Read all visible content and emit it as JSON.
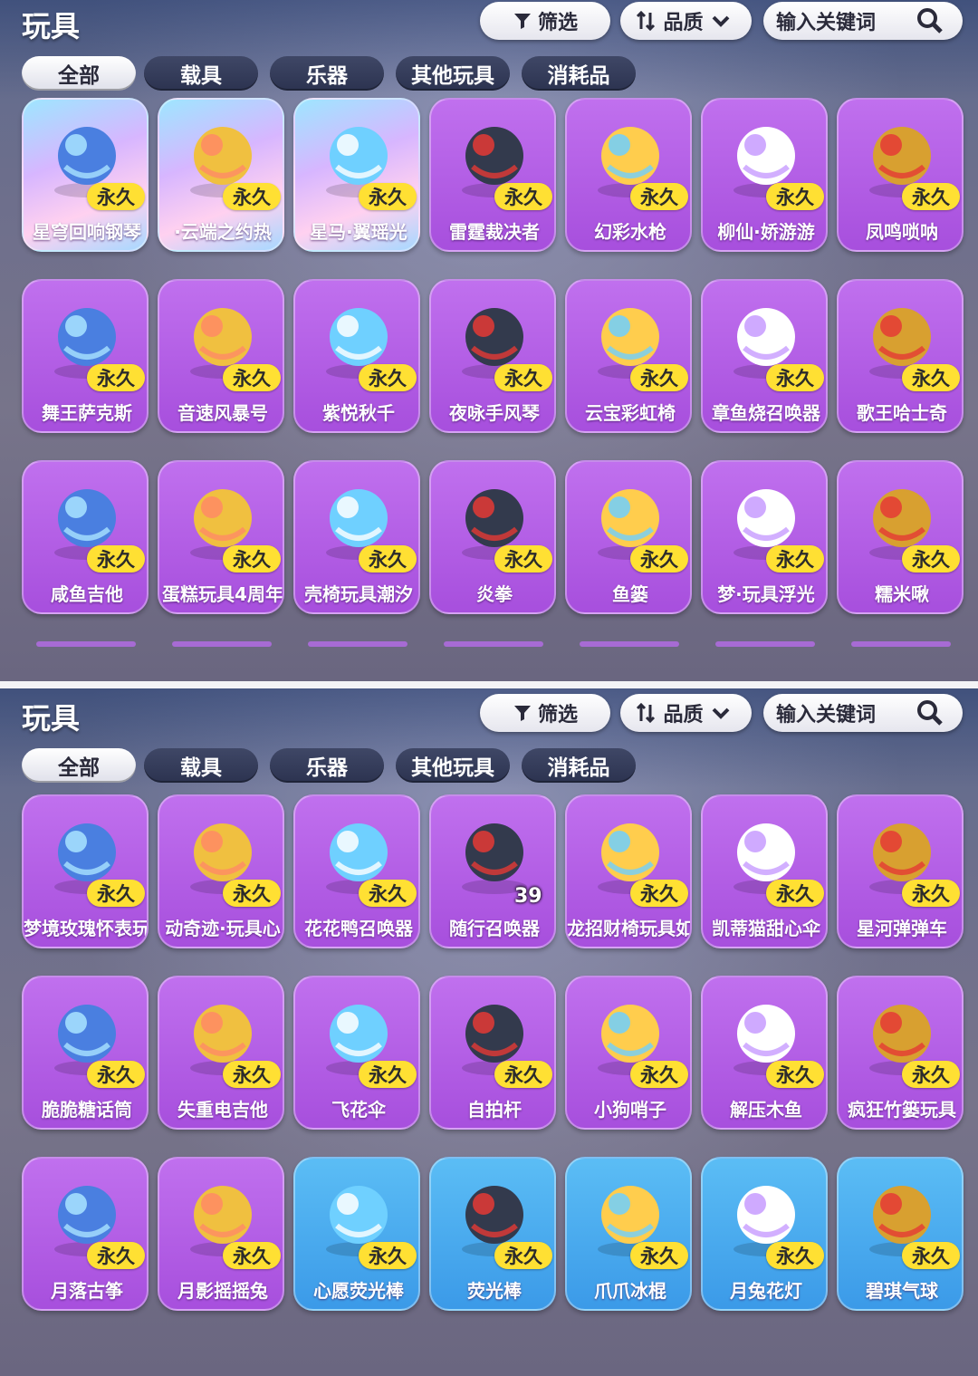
{
  "panels": [
    {
      "title": "玩具",
      "toolbar": {
        "filter_label": "筛选",
        "quality_label": "品质",
        "search_placeholder": "输入关键词"
      },
      "tabs": [
        "全部",
        "载具",
        "乐器",
        "其他玩具",
        "消耗品"
      ],
      "items": [
        {
          "name": "星穹回响钢琴",
          "badge": "永久",
          "style": "holo",
          "icon": "piano-icon"
        },
        {
          "name": "·云端之约热",
          "badge": "永久",
          "style": "holo",
          "icon": "balloon-carriage-icon"
        },
        {
          "name": "星马·翼瑶光",
          "badge": "永久",
          "style": "holo",
          "icon": "winged-horse-icon"
        },
        {
          "name": "雷霆裁决者",
          "badge": "永久",
          "style": "purple",
          "icon": "race-car-icon"
        },
        {
          "name": "幻彩水枪",
          "badge": "永久",
          "style": "purple",
          "icon": "water-gun-icon"
        },
        {
          "name": "柳仙·娇游游",
          "badge": "永久",
          "style": "purple",
          "icon": "spirit-creature-icon"
        },
        {
          "name": "凤鸣唢呐",
          "badge": "永久",
          "style": "purple",
          "icon": "suona-icon"
        },
        {
          "name": "舞王萨克斯",
          "badge": "永久",
          "style": "purple",
          "icon": "flower-saxophone-icon"
        },
        {
          "name": "音速风暴号",
          "badge": "永久",
          "style": "purple",
          "icon": "motorcycle-icon"
        },
        {
          "name": "紫悦秋千",
          "badge": "永久",
          "style": "purple",
          "icon": "swing-icon"
        },
        {
          "name": "夜咏手风琴",
          "badge": "永久",
          "style": "purple",
          "icon": "accordion-icon"
        },
        {
          "name": "云宝彩虹椅",
          "badge": "永久",
          "style": "purple",
          "icon": "cloud-chair-icon"
        },
        {
          "name": "章鱼烧召唤器",
          "badge": "永久",
          "style": "purple",
          "icon": "octopus-icon"
        },
        {
          "name": "歌王哈士奇",
          "badge": "永久",
          "style": "purple",
          "icon": "husky-icon"
        },
        {
          "name": "咸鱼吉他",
          "badge": "永久",
          "style": "purple",
          "icon": "fish-guitar-icon"
        },
        {
          "name": "蛋糕玩具4周年",
          "badge": "永久",
          "style": "purple",
          "icon": "cake-icon"
        },
        {
          "name": "壳椅玩具潮汐",
          "badge": "永久",
          "style": "purple",
          "icon": "shell-chair-icon"
        },
        {
          "name": "炎拳",
          "badge": "永久",
          "style": "purple",
          "icon": "fire-fist-icon"
        },
        {
          "name": "鱼篓",
          "badge": "永久",
          "style": "purple",
          "icon": "fish-basket-icon"
        },
        {
          "name": "梦·玩具浮光",
          "badge": "永久",
          "style": "purple",
          "icon": "lotus-icon"
        },
        {
          "name": "糯米啾",
          "badge": "永久",
          "style": "purple",
          "icon": "seal-bird-icon"
        }
      ]
    },
    {
      "title": "玩具",
      "toolbar": {
        "filter_label": "筛选",
        "quality_label": "品质",
        "search_placeholder": "输入关键词"
      },
      "tabs": [
        "全部",
        "载具",
        "乐器",
        "其他玩具",
        "消耗品"
      ],
      "items": [
        {
          "name": "梦境玫瑰怀表玩",
          "badge": "永久",
          "style": "purple",
          "icon": "pocket-watch-icon"
        },
        {
          "name": "动奇迹·玩具心",
          "badge": "永久",
          "style": "purple",
          "icon": "heart-wand-icon"
        },
        {
          "name": "花花鸭召唤器",
          "badge": "永久",
          "style": "purple",
          "icon": "duck-icon"
        },
        {
          "name": "随行召唤器",
          "badge": "",
          "count": "39",
          "style": "purple",
          "icon": "robot-icon"
        },
        {
          "name": "龙招财椅玩具如",
          "badge": "永久",
          "style": "purple",
          "icon": "fortune-chair-icon"
        },
        {
          "name": "凯蒂猫甜心伞",
          "badge": "永久",
          "style": "purple",
          "icon": "umbrella-icon"
        },
        {
          "name": "星河弹弹车",
          "badge": "永久",
          "style": "purple",
          "icon": "bumper-car-icon"
        },
        {
          "name": "脆脆糖话筒",
          "badge": "永久",
          "style": "purple",
          "icon": "microphone-icon"
        },
        {
          "name": "失重电吉他",
          "badge": "永久",
          "style": "purple",
          "icon": "electric-guitar-icon"
        },
        {
          "name": "飞花伞",
          "badge": "永久",
          "style": "purple",
          "icon": "parasol-icon"
        },
        {
          "name": "自拍杆",
          "badge": "永久",
          "style": "purple",
          "icon": "selfie-stick-icon"
        },
        {
          "name": "小狗哨子",
          "badge": "永久",
          "style": "purple",
          "icon": "whistle-icon"
        },
        {
          "name": "解压木鱼",
          "badge": "永久",
          "style": "purple",
          "icon": "wooden-fish-icon"
        },
        {
          "name": "疯狂竹篓玩具",
          "badge": "永久",
          "style": "purple",
          "icon": "bamboo-basket-icon"
        },
        {
          "name": "月落古筝",
          "badge": "永久",
          "style": "purple",
          "icon": "guzheng-icon"
        },
        {
          "name": "月影摇摇兔",
          "badge": "永久",
          "style": "purple",
          "icon": "rabbit-icon"
        },
        {
          "name": "心愿荧光棒",
          "badge": "永久",
          "style": "blue",
          "icon": "butterfly-wand-icon"
        },
        {
          "name": "荧光棒",
          "badge": "永久",
          "style": "blue",
          "icon": "planet-wand-icon"
        },
        {
          "name": "爪爪冰棍",
          "badge": "永久",
          "style": "blue",
          "icon": "paw-popsicle-icon"
        },
        {
          "name": "月兔花灯",
          "badge": "永久",
          "style": "blue",
          "icon": "rabbit-lantern-icon"
        },
        {
          "name": "碧琪气球",
          "badge": "永久",
          "style": "blue",
          "icon": "balloon-icon"
        }
      ]
    }
  ]
}
